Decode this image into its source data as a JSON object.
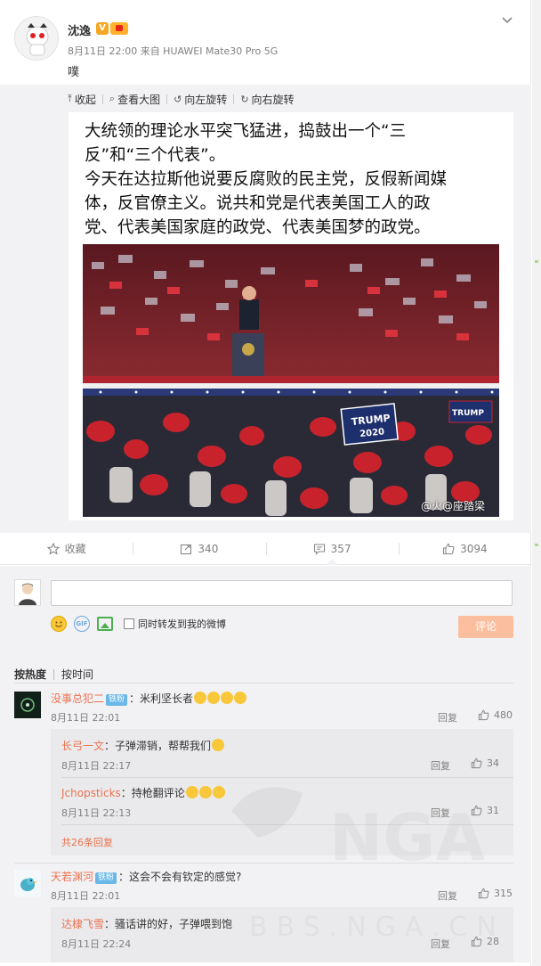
{
  "post": {
    "username": "沈逸",
    "v_badge": "V",
    "meta": "8月11日 22:00 来自 HUAWEI Mate30 Pro 5G",
    "text": "噗"
  },
  "media_tools": [
    {
      "icon": "collapse-icon",
      "glyph": "⤒",
      "label": "收起"
    },
    {
      "icon": "magnifier-icon",
      "glyph": "⌕",
      "label": "查看大图"
    },
    {
      "icon": "rotate-left-icon",
      "glyph": "↺",
      "label": "向左旋转"
    },
    {
      "icon": "rotate-right-icon",
      "glyph": "↻",
      "label": "向右旋转"
    }
  ],
  "image": {
    "lines": [
      "大统领的理论水平突飞猛进，捣鼓出一个“三",
      "反”和“三个代表”。",
      "今天在达拉斯他说要反腐败的民主党，反假新闻媒",
      "体，反官僚主义。说共和党是代表美国工人的政",
      "党、代表美国家庭的政党、代表美国梦的政党。"
    ],
    "sign_main": "TRUMP",
    "sign_year": "2020",
    "sign_right": "TRUMP",
    "watermark": "@火@座踏梁"
  },
  "actions": {
    "favorite": {
      "icon": "star-icon",
      "label": "收藏"
    },
    "repost": {
      "icon": "repost-icon",
      "label": "340"
    },
    "comment": {
      "icon": "comment-icon",
      "label": "357"
    },
    "like": {
      "icon": "thumbs-up-icon",
      "label": "3094"
    }
  },
  "composer": {
    "input_value": "",
    "sync_label": "同时转发到我的微博",
    "submit_label": "评论",
    "gif_label": "GIF"
  },
  "sort": {
    "hot": "按热度",
    "time": "按时间"
  },
  "comments": [
    {
      "user": "没事总犯二",
      "badge": "铁粉",
      "text": "：米利坚长者",
      "time": "8月11日 22:01",
      "reply": "回复",
      "likes": "480",
      "replies": [
        {
          "user": "长弓一文",
          "text": "：子弹滞销，帮帮我们",
          "time": "8月11日 22:17",
          "reply": "回复",
          "likes": "34"
        },
        {
          "user": "Jchopsticks",
          "text": "：持枪翻评论",
          "time": "8月11日 22:13",
          "reply": "回复",
          "likes": "31"
        }
      ],
      "more": "共26条回复"
    },
    {
      "user": "天若渊河",
      "badge": "铁粉",
      "text": "：这会不会有钦定的感觉?",
      "time": "8月11日 22:01",
      "reply": "回复",
      "likes": "315",
      "replies": [
        {
          "user": "达棣飞雪",
          "text": "：骚话讲的好，子弹喂到饱",
          "time": "8月11日 22:24",
          "reply": "回复",
          "likes": "28"
        }
      ]
    }
  ],
  "overlay_watermark": "BBS.NGA.CN",
  "colors": {
    "accent": "#eb7350",
    "submit_disabled": "#fbbf9f",
    "fan_badge": "#6ab8e8",
    "panel": "#f2f2f5"
  }
}
